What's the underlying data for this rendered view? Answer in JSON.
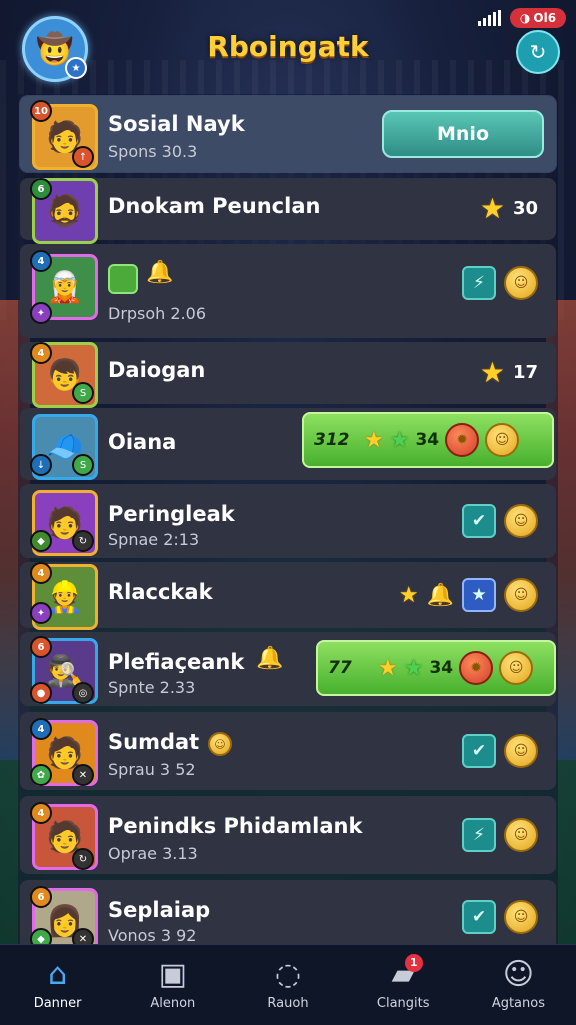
{
  "header": {
    "title": "Rboingatk",
    "battery_label": "Ol6",
    "refresh_icon": "refresh-icon"
  },
  "rows": [
    {
      "name": "Sosial Nayk",
      "sub": "Spons 30.3",
      "action": "Mnio"
    },
    {
      "name": "Dnokam Peunclan",
      "score": "30"
    },
    {
      "name": "",
      "sub": "Drpsoh 2.06"
    },
    {
      "name": "Daiogan",
      "score": "17"
    },
    {
      "name": "Oiana",
      "bonus_left": "312",
      "bonus_right": "34"
    },
    {
      "name": "Peringleak",
      "sub": "Spnae 2:13"
    },
    {
      "name": "Rlacckak"
    },
    {
      "name": "Plefiaçeank",
      "sub": "Spnte 2.33",
      "bonus_left": "77",
      "bonus_right": "34"
    },
    {
      "name": "Sumdat",
      "sub": "Sprau 3 52"
    },
    {
      "name": "Penindks Phidamlank",
      "sub": "Oprae 3.13"
    },
    {
      "name": "Seplaiap",
      "sub": "Vonos 3 92"
    }
  ],
  "nav": [
    {
      "label": "Danner",
      "icon": "home-icon",
      "active": true
    },
    {
      "label": "Alenon",
      "icon": "inbox-icon"
    },
    {
      "label": "Rauoh",
      "icon": "clock-icon"
    },
    {
      "label": "Clangits",
      "icon": "chat-icon",
      "badge": "1"
    },
    {
      "label": "Agtanos",
      "icon": "profile-icon"
    }
  ]
}
